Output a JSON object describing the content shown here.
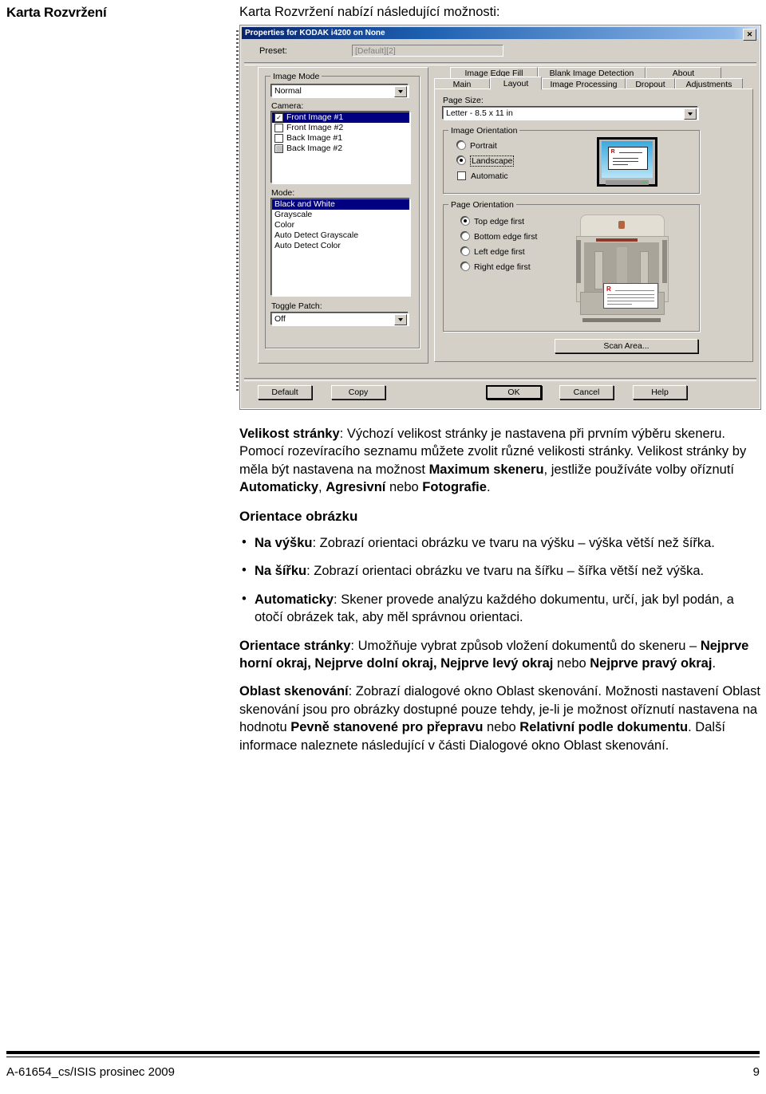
{
  "page": {
    "running_head": "Karta Rozvržení",
    "intro": "Karta Rozvržení nabízí následující možnosti:"
  },
  "dialog": {
    "title": "Properties for KODAK i4200 on None",
    "close_label": "✕",
    "preset": {
      "label": "Preset:",
      "value": "[Default][2]"
    },
    "image_mode": {
      "group_label": "Image Mode",
      "combo_value": "Normal",
      "camera_label": "Camera:",
      "camera_items": [
        {
          "label": "Front Image #1",
          "checked": true,
          "selected": true,
          "gray": false
        },
        {
          "label": "Front Image #2",
          "checked": false,
          "selected": false,
          "gray": false
        },
        {
          "label": "Back Image #1",
          "checked": false,
          "selected": false,
          "gray": false
        },
        {
          "label": "Back Image #2",
          "checked": false,
          "selected": false,
          "gray": true
        }
      ],
      "mode_label": "Mode:",
      "mode_items": [
        {
          "label": "Black and White",
          "selected": true
        },
        {
          "label": "Grayscale",
          "selected": false
        },
        {
          "label": "Color",
          "selected": false
        },
        {
          "label": "Auto Detect Grayscale",
          "selected": false
        },
        {
          "label": "Auto Detect Color",
          "selected": false
        }
      ],
      "toggle_patch_label": "Toggle Patch:",
      "toggle_patch_value": "Off"
    },
    "tabs_top": [
      "Image Edge Fill",
      "Blank Image Detection",
      "About"
    ],
    "tabs_bottom": [
      "Main",
      "Layout",
      "Image Processing",
      "Dropout",
      "Adjustments"
    ],
    "active_tab": "Layout",
    "page_size": {
      "label": "Page Size:",
      "value": "Letter - 8.5 x 11 in"
    },
    "image_orientation": {
      "group_label": "Image Orientation",
      "options": [
        {
          "label": "Portrait",
          "selected": false
        },
        {
          "label": "Landscape",
          "selected": true
        }
      ],
      "automatic_label": "Automatic",
      "automatic_checked": false
    },
    "page_orientation": {
      "group_label": "Page Orientation",
      "options": [
        {
          "label": "Top edge first",
          "selected": true
        },
        {
          "label": "Bottom edge first",
          "selected": false
        },
        {
          "label": "Left edge first",
          "selected": false
        },
        {
          "label": "Right edge first",
          "selected": false
        }
      ]
    },
    "scan_area_button": "Scan Area...",
    "buttons": {
      "default": "Default",
      "copy": "Copy",
      "ok": "OK",
      "cancel": "Cancel",
      "help": "Help"
    }
  },
  "content": {
    "page_size_para": {
      "lead": "Velikost stránky",
      "t1": ": Výchozí velikost stránky je nastavena při prvním výběru skeneru. Pomocí rozevíracího seznamu můžete zvolit různé velikosti stránky. Velikost stránky by měla být nastavena na možnost ",
      "b1": "Maximum skeneru",
      "t2": ", jestliže používáte volby oříznutí ",
      "b2": "Automaticky",
      "t3": ", ",
      "b3": "Agresivní",
      "t4": " nebo ",
      "b4": "Fotografie",
      "t5": "."
    },
    "heading_orientation": "Orientace obrázku",
    "bullet_portrait": {
      "lead": "Na výšku",
      "text": ": Zobrazí orientaci obrázku ve tvaru na výšku – výška větší než šířka."
    },
    "bullet_landscape": {
      "lead": "Na šířku",
      "text": ": Zobrazí orientaci obrázku ve tvaru na šířku – šířka větší než výška."
    },
    "bullet_automatic": {
      "lead": "Automaticky",
      "text": ": Skener provede analýzu každého dokumentu, určí, jak byl podán, a otočí obrázek tak, aby měl správnou orientaci."
    },
    "page_orientation_para": {
      "lead": "Orientace stránky",
      "t1": ": Umožňuje vybrat způsob vložení dokumentů do skeneru – ",
      "b1": "Nejprve horní okraj, Nejprve dolní okraj, Nejprve levý okraj",
      "t2": " nebo ",
      "b2": "Nejprve pravý okraj",
      "t3": "."
    },
    "scan_area_para": {
      "lead": "Oblast skenování",
      "t1": ": Zobrazí dialogové okno Oblast skenování. Možnosti nastavení Oblast skenování jsou pro obrázky dostupné pouze tehdy, je-li je možnost oříznutí nastavena na hodnotu ",
      "b1": "Pevně stanovené pro přepravu",
      "t2": " nebo ",
      "b2": "Relativní podle dokumentu",
      "t3": ". Další informace naleznete následující v části Dialogové okno Oblast skenování."
    }
  },
  "footer": {
    "left": "A-61654_cs/ISIS  prosinec 2009",
    "right": "9"
  }
}
